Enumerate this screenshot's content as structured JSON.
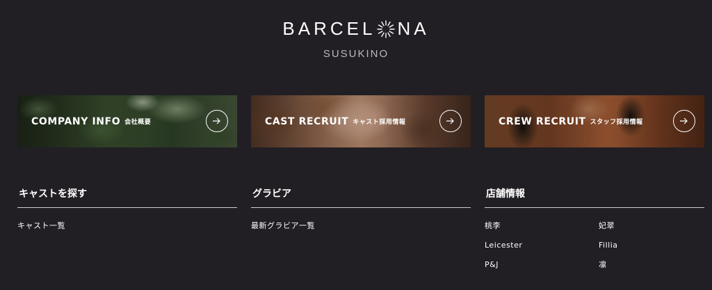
{
  "logo": {
    "main_pre": "BARCEL",
    "main_post": "NA",
    "sub": "SUSUKINO"
  },
  "banners": [
    {
      "en": "COMPANY INFO",
      "ja": "会社概要"
    },
    {
      "en": "CAST RECRUIT",
      "ja": "キャスト採用情報"
    },
    {
      "en": "CREW RECRUIT",
      "ja": "スタッフ採用情報"
    }
  ],
  "sections": {
    "cast": {
      "title": "キャストを探す",
      "links": [
        "キャスト一覧"
      ]
    },
    "gravure": {
      "title": "グラビア",
      "links": [
        "最新グラビア一覧"
      ]
    },
    "shops": {
      "title": "店舗情報",
      "links": [
        "桃李",
        "妃翠",
        "Leicester",
        "Fillia",
        "P&J",
        "凛"
      ]
    }
  },
  "icons": {
    "arrow": "arrow-right-icon",
    "logo": "sun-burst-icon"
  }
}
